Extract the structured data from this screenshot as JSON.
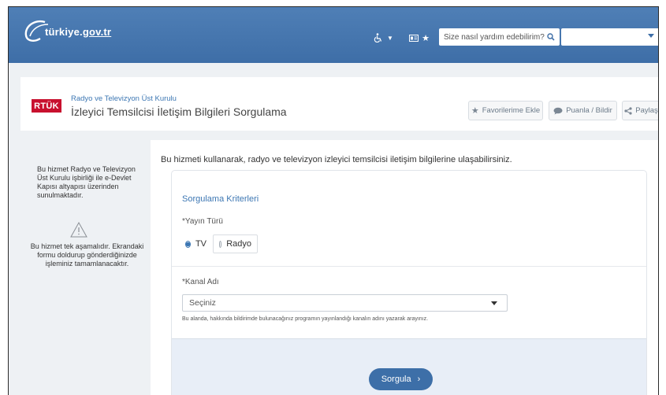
{
  "brand": {
    "logo_text_a": "türkiye.",
    "logo_text_b": "gov.tr"
  },
  "topbar": {
    "accessibility_icon": "wheelchair-icon",
    "favorites_icon": "star-icon",
    "search_placeholder": "Size nasıl yardım edebilirim?"
  },
  "header": {
    "institution": "Radyo ve Televizyon Üst Kurulu",
    "logo": "RTÜK",
    "title": "İzleyici Temsilcisi İletişim Bilgileri Sorgulama",
    "buttons": [
      {
        "label": "Favorilerime Ekle",
        "icon": "star-icon"
      },
      {
        "label": "Puanla / Bildir",
        "icon": "speech-bubble-icon"
      },
      {
        "label": "Paylaş",
        "icon": "share-icon"
      }
    ]
  },
  "sidebar": {
    "info": "Bu hizmet Radyo ve Televizyon Üst Kurulu işbirliği ile e-Devlet Kapısı altyapısı üzerinden sunulmaktadır.",
    "notice": "Bu hizmet tek aşamalıdır. Ekrandaki formu doldurup gönderdiğinizde işleminiz tamamlanacaktır."
  },
  "main": {
    "intro": "Bu hizmeti kullanarak, radyo ve televizyon izleyici temsilcisi iletişim bilgilerine ulaşabilirsiniz.",
    "card_title": "Sorgulama Kriterleri",
    "broadcast_label": "*Yayın Türü",
    "options": [
      "TV",
      "Radyo"
    ],
    "selected_option": "TV",
    "channel_label": "*Kanal Adı",
    "channel_value": "Seçiniz",
    "hint": "Bu alanda, hakkında bildirimde bulunacağınız programın yayınlandığı kanalın adını yazarak arayınız.",
    "submit": "Sorgula"
  },
  "colors": {
    "topbar": "#4a7ab2",
    "accent": "#3d77b3",
    "rtuk_red": "#c8102e"
  }
}
